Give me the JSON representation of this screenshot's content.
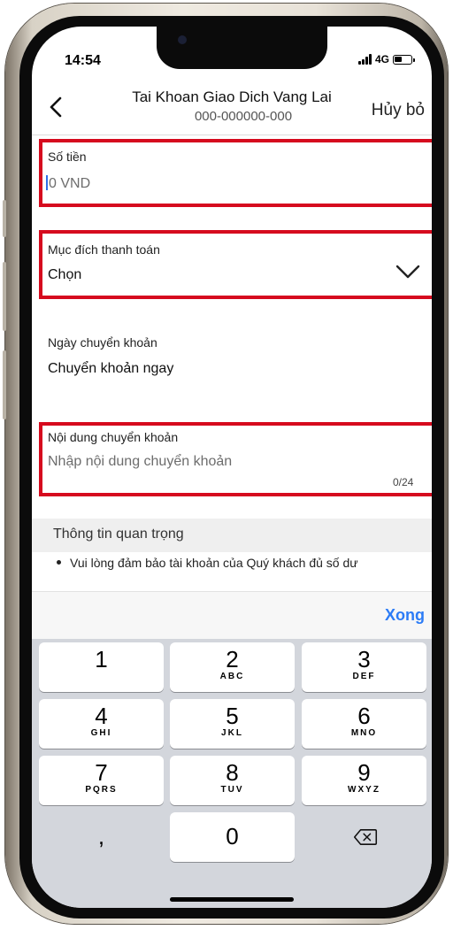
{
  "status_bar": {
    "time": "14:54",
    "network": "4G"
  },
  "header": {
    "title": "Tai Khoan Giao Dich Vang Lai",
    "account": "000-000000-000",
    "cancel_label": "Hủy bỏ"
  },
  "form": {
    "amount": {
      "label": "Số tiền",
      "placeholder": "0 VND"
    },
    "purpose": {
      "label": "Mục đích thanh toán",
      "value": "Chọn"
    },
    "date": {
      "label": "Ngày chuyển khoản",
      "value": "Chuyển khoản ngay"
    },
    "content": {
      "label": "Nội dung chuyển khoản",
      "placeholder": "Nhập nội dung chuyển khoản",
      "counter": "0/24"
    }
  },
  "info": {
    "title": "Thông tin quan trọng",
    "items": [
      "Vui lòng đảm bảo tài khoản của Quý khách đủ số dư"
    ]
  },
  "keyboard": {
    "done_label": "Xong",
    "keys": [
      {
        "digit": "1",
        "letters": ""
      },
      {
        "digit": "2",
        "letters": "ABC"
      },
      {
        "digit": "3",
        "letters": "DEF"
      },
      {
        "digit": "4",
        "letters": "GHI"
      },
      {
        "digit": "5",
        "letters": "JKL"
      },
      {
        "digit": "6",
        "letters": "MNO"
      },
      {
        "digit": "7",
        "letters": "PQRS"
      },
      {
        "digit": "8",
        "letters": "TUV"
      },
      {
        "digit": "9",
        "letters": "WXYZ"
      },
      {
        "digit": "0",
        "letters": ""
      }
    ],
    "comma": ",",
    "delete_icon": "backspace-icon"
  },
  "colors": {
    "highlight": "#d60a1e",
    "accent": "#2c7cf6",
    "cursor": "#2f6fe8"
  }
}
